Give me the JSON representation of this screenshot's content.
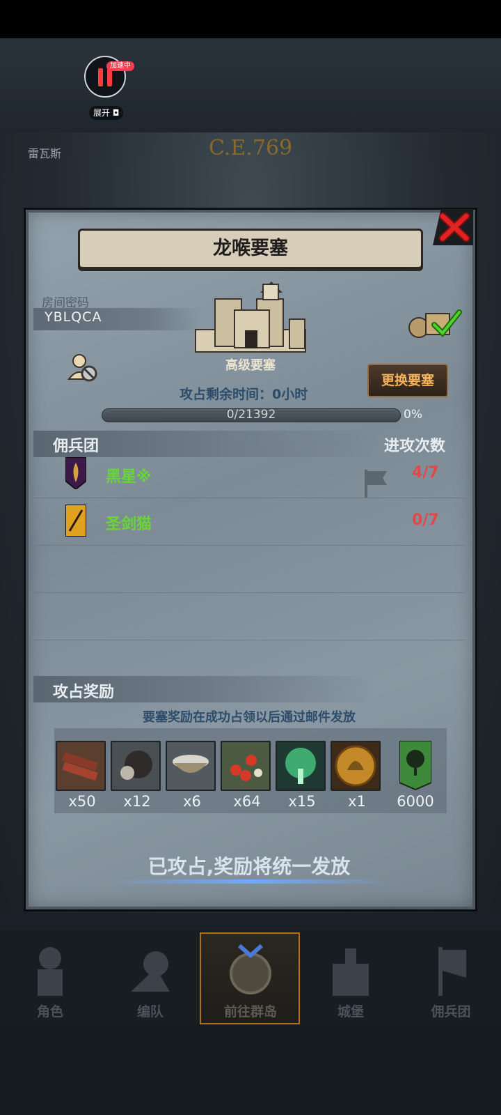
{
  "overlay": {
    "speed_badge": "加速中",
    "expand_label": "展开"
  },
  "world": {
    "era": "C.E.769",
    "city_tab": "雷瓦斯"
  },
  "panel": {
    "title": "龙喉要塞",
    "room_label": "房间密码",
    "room_code": "YBLQCA",
    "fortress_level": "高级要塞",
    "change_button": "更换要塞",
    "time_label": "攻占剩余时间：0小时",
    "progress_text": "0/21392",
    "progress_value": 0,
    "progress_max": 21392,
    "progress_pct": "0%",
    "merc_header": "佣兵团",
    "attack_header": "进攻次数",
    "guilds": [
      {
        "name": "黑星※",
        "count": "4/7"
      },
      {
        "name": "圣剑猫",
        "count": "0/7"
      }
    ],
    "reward_header": "攻占奖励",
    "reward_note": "要塞奖励在成功占领以后通过邮件发放",
    "rewards": [
      {
        "icon": "wood-icon",
        "count": "x50"
      },
      {
        "icon": "ore-icon",
        "count": "x12"
      },
      {
        "icon": "bowl-icon",
        "count": "x6"
      },
      {
        "icon": "berries-icon",
        "count": "x64"
      },
      {
        "icon": "spirit-tree-icon",
        "count": "x15"
      },
      {
        "icon": "knight-medal-icon",
        "count": "x1"
      },
      {
        "icon": "tree-banner-icon",
        "count": "6000"
      }
    ],
    "claim_text": "已攻占,奖励将统一发放"
  },
  "nav": {
    "items": [
      {
        "label": "角色"
      },
      {
        "label": "编队"
      },
      {
        "label": "前往群岛"
      },
      {
        "label": "城堡"
      },
      {
        "label": "佣兵团"
      }
    ]
  },
  "colors": {
    "guild_name": "#68d636",
    "count_red": "#e44747",
    "button_text": "#f4b25a"
  }
}
